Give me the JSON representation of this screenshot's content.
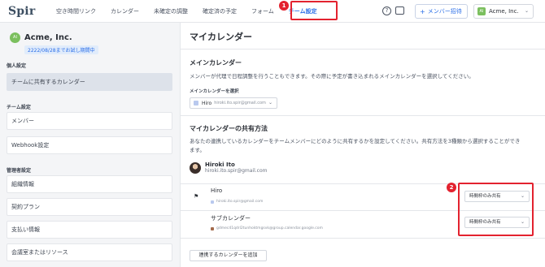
{
  "header": {
    "logo": "Spir",
    "nav": [
      "空き時間リンク",
      "カレンダー",
      "未確定の調整",
      "確定済の予定",
      "フォーム",
      "チーム設定"
    ],
    "active_nav": "チーム設定",
    "invite_label": "メンバー招待",
    "account_initials": "AI",
    "account_name": "Acme, Inc.",
    "help_glyph": "?"
  },
  "annotations": {
    "badge1": "1",
    "badge2": "2",
    "highlight_color": "#e3222f"
  },
  "sidebar": {
    "org_initials": "AI",
    "org_name": "Acme, Inc.",
    "trial_badge": "2222/08/28までお試し期間中",
    "personal_label": "個人設定",
    "personal_items": [
      "チームに共有するカレンダー"
    ],
    "team_label": "チーム設定",
    "team_items": [
      "メンバー",
      "Webhook設定"
    ],
    "admin_label": "管理者設定",
    "admin_items": [
      "組織情報",
      "契約プラン",
      "支払い情報",
      "会議室またはリソース"
    ]
  },
  "main": {
    "title": "マイカレンダー",
    "main_cal": {
      "heading": "メインカレンダー",
      "desc": "メンバーが代理で日程調整を行うこともできます。その際に予定が書き込まれるメインカレンダーを選択してください。",
      "select_label": "メインカレンダーを選択",
      "selected_name": "Hiro",
      "selected_email": "hiroki.ito.spir@gmail.com",
      "selected_color": "#b9c9ee"
    },
    "share": {
      "heading": "マイカレンダーの共有方法",
      "desc_line1": "あなたの連携しているカレンダーをチームメンバーにどのように共有するかを設定してください。共有方法を3種類から選択することができ",
      "desc_line2": "ます。",
      "user_name": "Hiroki Ito",
      "user_email": "hiroki.ito.spir@gmail.com",
      "calendars": [
        {
          "name": "Hiro",
          "email": "hiroki.ito.spir@gmail.com",
          "color": "#b9c9ee",
          "share_option": "時間枠のみ共有"
        },
        {
          "name": "サブカレンダー",
          "email": "gdmec41qdrl2tunhoktmgsvk@group.calendar.google.com",
          "color": "#a36a4b",
          "share_option": "時間枠のみ共有"
        }
      ],
      "add_button": "連携するカレンダーを追加"
    }
  },
  "colors": {
    "accent": "#2a6ee8",
    "brand_green": "#7bbf5e"
  },
  "icons": {
    "chevron": "chevron-down-icon",
    "flag": "flag-icon",
    "invite": "person-add-icon"
  }
}
